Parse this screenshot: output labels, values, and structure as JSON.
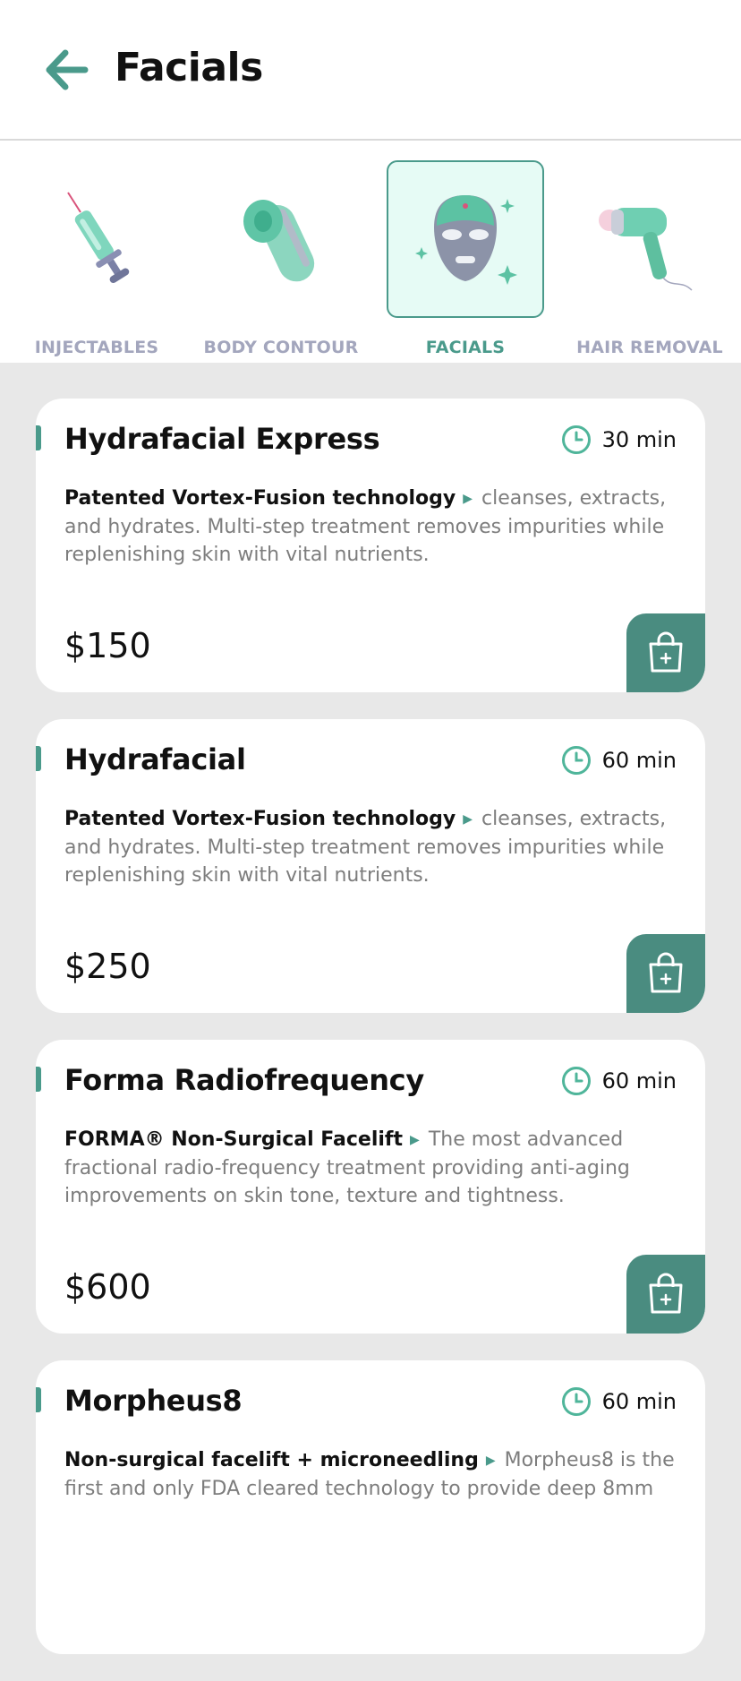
{
  "header": {
    "title": "Facials",
    "back_icon": "arrow-left-icon"
  },
  "colors": {
    "accent": "#4a9a8b",
    "cart_button": "#4a8c80",
    "active_tile_bg": "#e6fbf5",
    "inactive_label": "#a3a6bd",
    "background": "#e8e8e8"
  },
  "categories": [
    {
      "label": "INJECTABLES",
      "icon": "syringe-icon",
      "active": false
    },
    {
      "label": "BODY CONTOUR",
      "icon": "body-contour-device-icon",
      "active": false
    },
    {
      "label": "FACIALS",
      "icon": "face-mask-icon",
      "active": true
    },
    {
      "label": "HAIR REMOVAL",
      "icon": "laser-device-icon",
      "active": false
    }
  ],
  "treatments": [
    {
      "title": "Hydrafacial Express",
      "duration": "30 min",
      "lead": "Patented Vortex-Fusion technology",
      "description": "cleanses, extracts, and hydrates. Multi-step treatment removes impurities while replenishing skin with vital nutrients.",
      "price": "$150"
    },
    {
      "title": "Hydrafacial",
      "duration": "60 min",
      "lead": "Patented Vortex-Fusion technology",
      "description": "cleanses, extracts, and hydrates. Multi-step treatment removes impurities while replenishing skin with vital nutrients.",
      "price": "$250"
    },
    {
      "title": "Forma Radiofrequency",
      "duration": "60 min",
      "lead": "FORMA® Non-Surgical Facelift",
      "description": "The most advanced fractional radio-frequency treatment providing anti-aging improvements on skin tone, texture and tightness.",
      "price": "$600"
    },
    {
      "title": "Morpheus8",
      "duration": "60 min",
      "lead": "Non-surgical facelift + microneedling",
      "description": "Morpheus8 is the first and only FDA cleared technology to provide deep 8mm",
      "price": ""
    }
  ]
}
